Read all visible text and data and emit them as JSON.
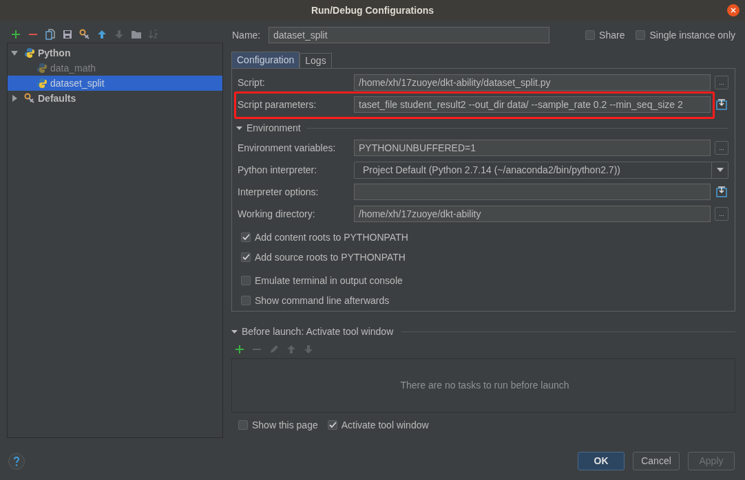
{
  "window": {
    "title": "Run/Debug Configurations"
  },
  "toolbar": [
    {
      "kind": "add",
      "disabled": false
    },
    {
      "kind": "remove",
      "disabled": false
    },
    {
      "kind": "copy",
      "disabled": false
    },
    {
      "kind": "save",
      "disabled": false
    },
    {
      "kind": "wrench",
      "disabled": false
    },
    {
      "kind": "up",
      "disabled": false
    },
    {
      "kind": "down",
      "disabled": true
    },
    {
      "kind": "folder",
      "disabled": false
    },
    {
      "kind": "sort",
      "disabled": true
    }
  ],
  "tree": [
    {
      "label": "Python",
      "kind": "python",
      "expanded": true,
      "selected": false,
      "dimmed": false,
      "children": [
        {
          "label": "data_math",
          "kind": "python",
          "selected": false,
          "dimmed": true
        },
        {
          "label": "dataset_split",
          "kind": "python",
          "selected": true,
          "dimmed": false
        }
      ]
    },
    {
      "label": "Defaults",
      "kind": "wrench",
      "expanded": false,
      "selected": false,
      "dimmed": false
    }
  ],
  "name_field": {
    "label": "Name:",
    "value": "dataset_split"
  },
  "options": [
    {
      "label": "Share",
      "checked": false
    },
    {
      "label": "Single instance only",
      "checked": false
    }
  ],
  "tabs": [
    {
      "label": "Configuration",
      "selected": true
    },
    {
      "label": "Logs",
      "selected": false
    }
  ],
  "script_fields": [
    {
      "kind": "text",
      "label": "Script:",
      "value": "/home/xh/17zuoye/dkt-ability/dataset_split.py",
      "button": "...",
      "highlighted": false
    },
    {
      "kind": "expand",
      "label": "Script parameters:",
      "value": "taset_file student_result2 --out_dir data/ --sample_rate 0.2 --min_seq_size 2",
      "highlighted": true
    }
  ],
  "environment": {
    "label": "Environment",
    "expanded": true
  },
  "env_fields": [
    {
      "kind": "text",
      "label": "Environment variables:",
      "value": "PYTHONUNBUFFERED=1",
      "button": "..."
    },
    {
      "kind": "combo",
      "label": "Python interpreter:",
      "value": "Project Default (Python 2.7.14 (~/anaconda2/bin/python2.7))"
    },
    {
      "kind": "expand",
      "label": "Interpreter options:"
    },
    {
      "kind": "text",
      "label": "Working directory:",
      "value": "/home/xh/17zuoye/dkt-ability",
      "button": "..."
    }
  ],
  "checkboxes": [
    {
      "label": "Add content roots to PYTHONPATH",
      "checked": true
    },
    {
      "label": "Add source roots to PYTHONPATH",
      "checked": true
    },
    {
      "label": "Emulate terminal in output console",
      "checked": false
    },
    {
      "label": "Show command line afterwards",
      "checked": false
    }
  ],
  "before_launch": {
    "label": "Before launch: Activate tool window",
    "expanded": true,
    "toolbar": [
      {
        "kind": "add",
        "disabled": false
      },
      {
        "kind": "remove",
        "disabled": true
      },
      {
        "kind": "edit",
        "disabled": true
      },
      {
        "kind": "up",
        "disabled": true
      },
      {
        "kind": "down",
        "disabled": true
      }
    ],
    "empty_text": "There are no tasks to run before launch"
  },
  "launch_options": [
    {
      "label": "Show this page",
      "checked": false
    },
    {
      "label": "Activate tool window",
      "checked": true
    }
  ],
  "buttons": [
    {
      "label": "OK",
      "kind": "primary",
      "disabled": false
    },
    {
      "label": "Cancel",
      "kind": "normal",
      "disabled": false
    },
    {
      "label": "Apply",
      "kind": "normal",
      "disabled": true
    }
  ]
}
